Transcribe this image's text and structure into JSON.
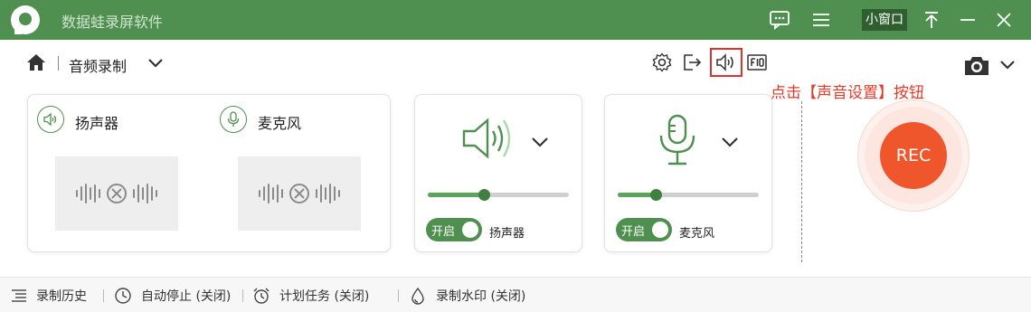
{
  "app": {
    "title": "数据蛙录屏软件",
    "mini_window": "小窗口"
  },
  "toolbar": {
    "mode": "音频录制"
  },
  "annotation": "点击【声音设置】按钮",
  "devices": [
    {
      "label": "扬声器"
    },
    {
      "label": "麦克风"
    }
  ],
  "speaker_panel": {
    "toggle": "开启",
    "label": "扬声器",
    "volume": 0.4
  },
  "mic_panel": {
    "toggle": "开启",
    "label": "麦克风",
    "volume": 0.27
  },
  "record_button": {
    "label": "REC"
  },
  "statusbar": {
    "history": "录制历史",
    "auto_stop": "自动停止 (关闭)",
    "schedule": "计划任务 (关闭)",
    "watermark": "录制水印 (关闭)"
  },
  "colors": {
    "brand": "#4f8f4f",
    "rec": "#f0562c",
    "annotation": "#e23b2a"
  }
}
